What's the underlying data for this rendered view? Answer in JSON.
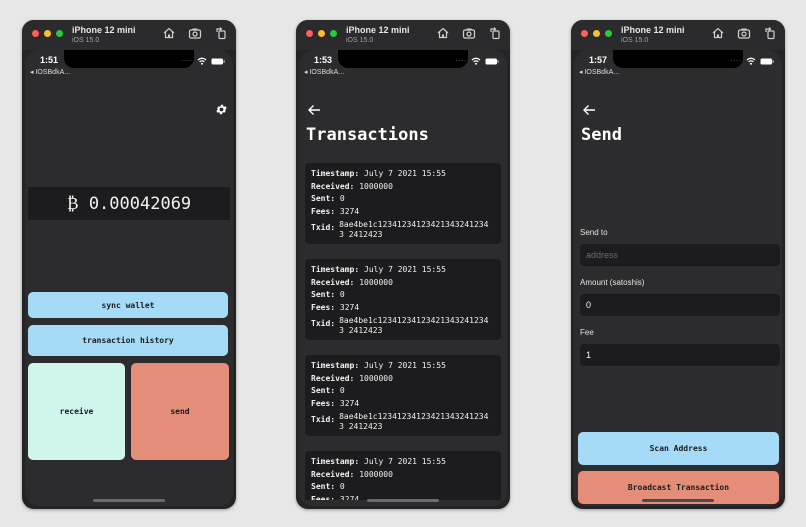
{
  "simulators": [
    {
      "device_name": "iPhone 12 mini",
      "os_version": "iOS 15.0",
      "status_time": "1:51",
      "back_app": "◂ IOSBdkA...",
      "home": {
        "balance": "₿ 0.00042069",
        "buttons": {
          "sync": "sync wallet",
          "history": "transaction history",
          "receive": "receive",
          "send": "send"
        }
      }
    },
    {
      "device_name": "iPhone 12 mini",
      "os_version": "iOS 15.0",
      "status_time": "1:53",
      "back_app": "◂ IOSBdkA...",
      "transactions": {
        "title": "Transactions",
        "labels": {
          "timestamp": "Timestamp:",
          "received": "Received:",
          "sent": "Sent:",
          "fees": "Fees:",
          "txid": "Txid:"
        },
        "items": [
          {
            "timestamp": "July 7 2021 15:55",
            "received": "1000000",
            "sent": "0",
            "fees": "3274",
            "txid": "8ae4be1c123412341234213432412343 2412423"
          },
          {
            "timestamp": "July 7 2021 15:55",
            "received": "1000000",
            "sent": "0",
            "fees": "3274",
            "txid": "8ae4be1c123412341234213432412343 2412423"
          },
          {
            "timestamp": "July 7 2021 15:55",
            "received": "1000000",
            "sent": "0",
            "fees": "3274",
            "txid": "8ae4be1c123412341234213432412343 2412423"
          },
          {
            "timestamp": "July 7 2021 15:55",
            "received": "1000000",
            "sent": "0",
            "fees": "3274"
          }
        ]
      }
    },
    {
      "device_name": "iPhone 12 mini",
      "os_version": "iOS 15.0",
      "status_time": "1:57",
      "back_app": "◂ IOSBdkA...",
      "send": {
        "title": "Send",
        "send_to_label": "Send to",
        "address_placeholder": "address",
        "amount_label": "Amount (satoshis)",
        "amount_value": "0",
        "fee_label": "Fee",
        "fee_value": "1",
        "scan_button": "Scan Address",
        "broadcast_button": "Broadcast Transaction"
      }
    }
  ],
  "colors": {
    "page_background": "#e7e7e7",
    "app_background": "#2c2c2e",
    "card_background": "#1c1c1e",
    "blue_button": "#a5dbf7",
    "mint_button": "#cff5ec",
    "salmon_button": "#e48d79",
    "traffic_red": "#fe5f57",
    "traffic_yellow": "#febc2e",
    "traffic_green": "#28c840"
  },
  "icons": [
    "home-icon",
    "screenshot-icon",
    "rotate-icon",
    "gear-icon",
    "back-arrow-icon",
    "wifi-icon",
    "battery-icon"
  ]
}
